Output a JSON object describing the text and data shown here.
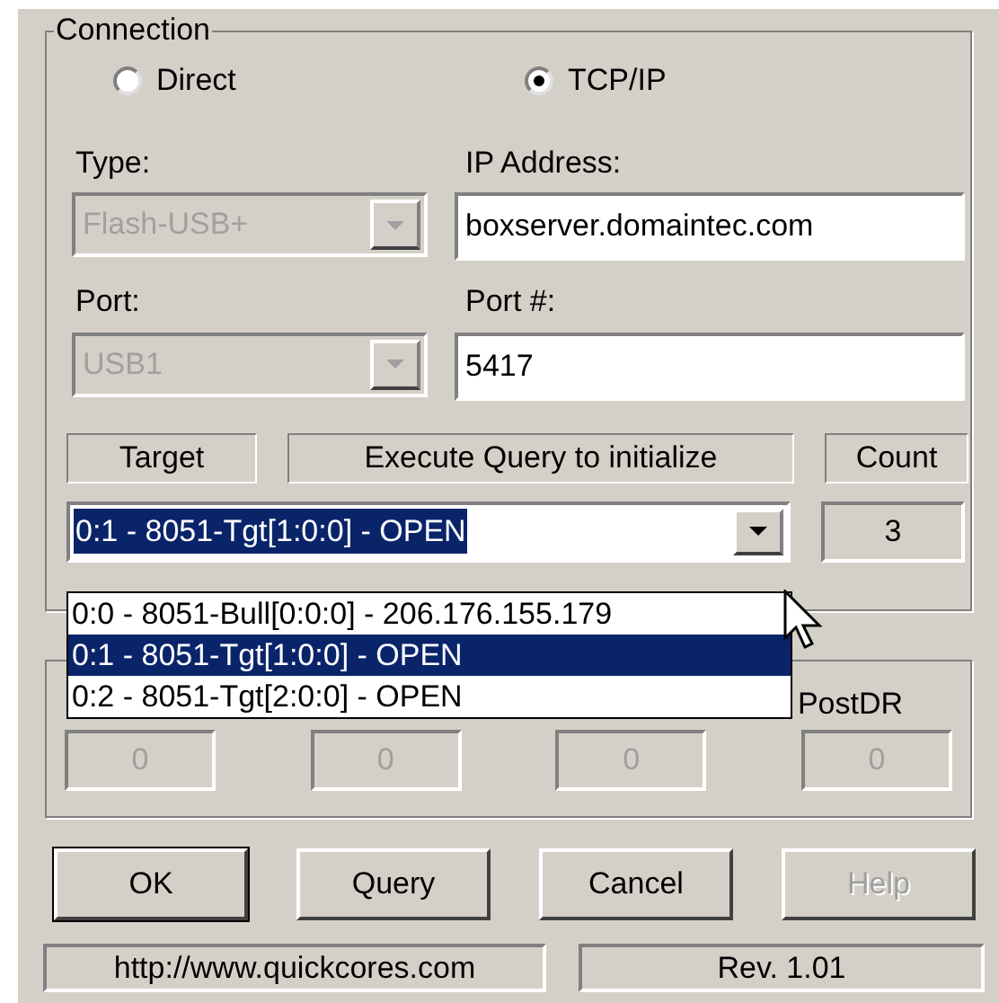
{
  "connection": {
    "title": "Connection",
    "modes": [
      {
        "label": "Direct",
        "selected": false
      },
      {
        "label": "TCP/IP",
        "selected": true
      }
    ],
    "type": {
      "label": "Type:",
      "value": "Flash-USB+",
      "disabled": true
    },
    "ip_address": {
      "label": "IP Address:",
      "value": "boxserver.domaintec.com"
    },
    "port": {
      "label": "Port:",
      "value": "USB1",
      "disabled": true
    },
    "port_number": {
      "label": "Port #:",
      "value": "5417"
    },
    "headers": [
      "Target",
      "Execute Query to initialize",
      "Count"
    ],
    "target": {
      "value": "0:1 - 8051-Tgt[1:0:0] - OPEN",
      "expanded": true,
      "options": [
        {
          "label": "0:0 - 8051-Bull[0:0:0] - 206.176.155.179",
          "selected": false
        },
        {
          "label": "0:1 - 8051-Tgt[1:0:0] - OPEN",
          "selected": true
        },
        {
          "label": "0:2 - 8051-Tgt[2:0:0] - OPEN",
          "selected": false
        }
      ]
    },
    "count": "3"
  },
  "scan": {
    "fields": [
      {
        "value": "0",
        "disabled": true
      },
      {
        "value": "0",
        "disabled": true
      },
      {
        "value": "0",
        "disabled": true
      },
      {
        "label": "PostDR",
        "value": "0",
        "disabled": true
      }
    ]
  },
  "buttons": [
    {
      "label": "OK",
      "default": true,
      "disabled": false
    },
    {
      "label": "Query",
      "default": false,
      "disabled": false
    },
    {
      "label": "Cancel",
      "default": false,
      "disabled": false
    },
    {
      "label": "Help",
      "default": false,
      "disabled": true
    }
  ],
  "status_bar": [
    "http://www.quickcores.com",
    "Rev. 1.01"
  ]
}
